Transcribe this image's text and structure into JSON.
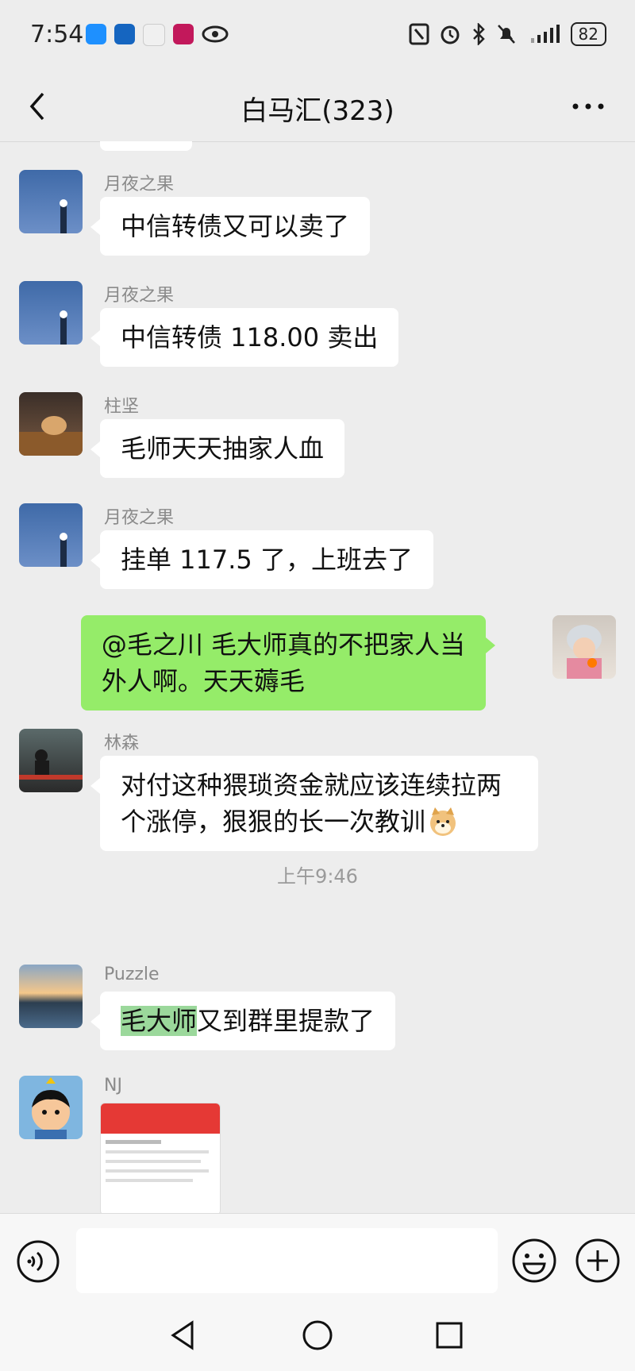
{
  "status_bar": {
    "time": "7:54",
    "battery": "82"
  },
  "header": {
    "title": "白马汇(323)"
  },
  "messages": [
    {
      "sender": "月夜之果",
      "text": "中信转债又可以卖了"
    },
    {
      "sender": "月夜之果",
      "text": "中信转债 118.00 卖出"
    },
    {
      "sender": "柱坚",
      "text": "毛师天天抽家人血"
    },
    {
      "sender": "月夜之果",
      "text": "挂单 117.5 了，上班去了"
    },
    {
      "sender": "me",
      "line1": "@毛之川  毛大师真的不把家人当",
      "line2": "外人啊。天天薅毛"
    },
    {
      "sender": "林森",
      "line1": "对付这种猥琐资金就应该连续拉两",
      "line2": "个涨停，狠狠的长一次教训"
    },
    {
      "sender": "Puzzle",
      "highlight": "毛大师",
      "rest": "又到群里提款了"
    },
    {
      "sender": "NJ",
      "image": "screenshot-thumbnail"
    }
  ],
  "time_divider": "上午9:46",
  "input": {
    "placeholder": ""
  },
  "colors": {
    "background": "#ededed",
    "bubble_self": "#95ec69",
    "bubble_other": "#ffffff",
    "highlight": "#9bd89b"
  }
}
